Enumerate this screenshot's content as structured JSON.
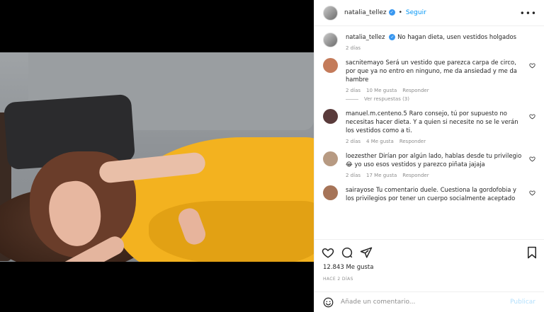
{
  "post": {
    "username": "natalia_tellez",
    "follow_label": "Seguir",
    "separator": "•",
    "caption": "No hagan dieta, usen vestidos holgados",
    "caption_time": "2 días",
    "likes": "12.843 Me gusta",
    "date": "HACE 2 DÍAS"
  },
  "comments": [
    {
      "username": "sacnitemayo",
      "text": "Será un vestido que parezca carpa de circo, por que ya no entro en ninguno, me da ansiedad y me da hambre",
      "time": "2 días",
      "likes": "10 Me gusta",
      "reply_label": "Responder",
      "avatar_color": "#c47b5a",
      "view_replies": "Ver respuestas (3)"
    },
    {
      "username": "manuel.m.centeno.5",
      "text": "Raro consejo, tú por supuesto no necesitas hacer dieta. Y a quien si necesite no se le verán los vestidos como a ti.",
      "time": "2 días",
      "likes": "4 Me gusta",
      "reply_label": "Responder",
      "avatar_color": "#5a3b3b"
    },
    {
      "username": "loezesther",
      "text": "Dirían por algún lado, hablas desde tu privilegio 😂 yo uso esos vestidos y parezco piñata jajaja",
      "time": "2 días",
      "likes": "17 Me gusta",
      "reply_label": "Responder",
      "avatar_color": "#b79a82"
    },
    {
      "username": "sairayose",
      "text": "Tu comentario duele. Cuestiona la gordofobia y los privilegios por tener un cuerpo socialmente aceptado",
      "avatar_color": "#a67458"
    }
  ],
  "add_comment": {
    "placeholder": "Añade un comentario...",
    "publish_label": "Publicar"
  },
  "icons": {
    "more": "more-options-icon",
    "like": "heart-icon",
    "comment": "comment-icon",
    "share": "share-icon",
    "save": "bookmark-icon",
    "emoji": "emoji-icon",
    "verified": "verified-badge-icon"
  },
  "colors": {
    "link_blue": "#0095f6",
    "verified_blue": "#3897f0",
    "muted_gray": "#8e8e8e",
    "dress_yellow": "#f3b21f"
  }
}
